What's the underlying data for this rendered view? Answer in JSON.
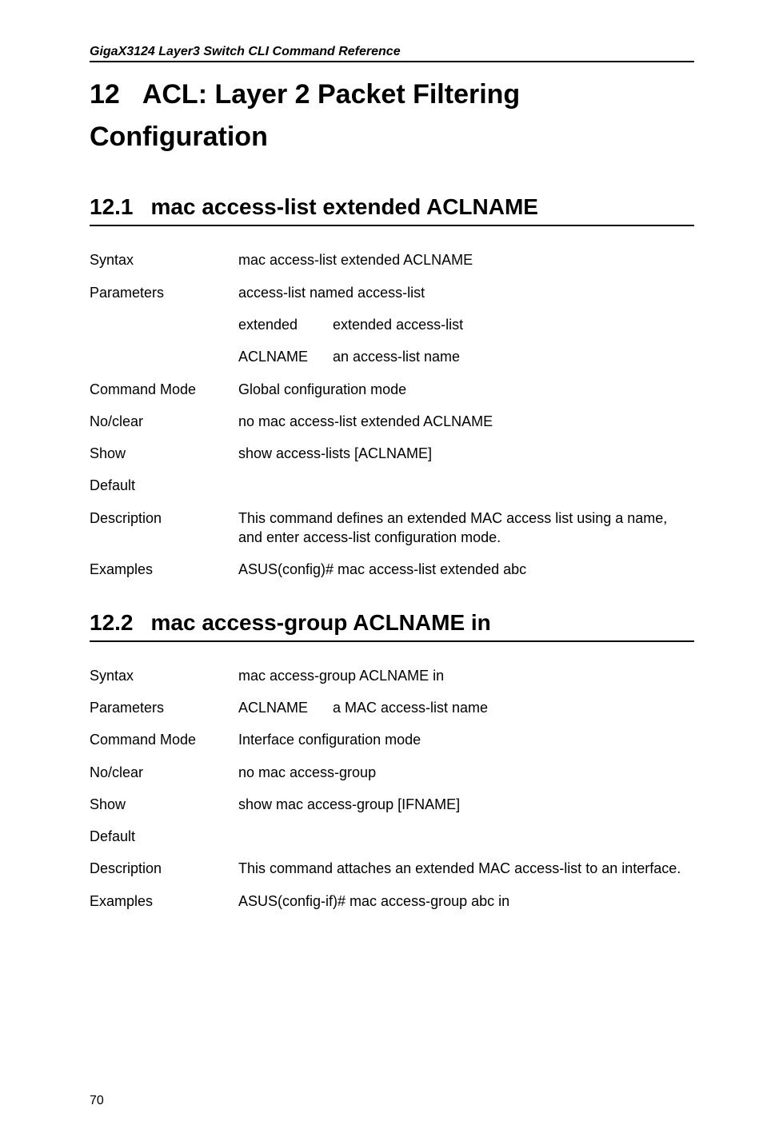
{
  "running_header": "GigaX3124 Layer3 Switch CLI Command Reference",
  "chapter": {
    "number": "12",
    "title": "ACL: Layer 2 Packet Filtering Configuration"
  },
  "section1": {
    "number": "12.1",
    "title": "mac access-list extended ACLNAME",
    "rows": {
      "syntax_label": "Syntax",
      "syntax_value": "mac access-list extended ACLNAME",
      "parameters_label": "Parameters",
      "parameters_value": "access-list named access-list",
      "param_extended_key": "extended",
      "param_extended_val": "extended access-list",
      "param_aclname_key": "ACLNAME",
      "param_aclname_val": "an access-list name",
      "command_mode_label": "Command Mode",
      "command_mode_value": "Global configuration mode",
      "noclear_label": "No/clear",
      "noclear_value": "no mac access-list extended ACLNAME",
      "show_label": "Show",
      "show_value": "show access-lists [ACLNAME]",
      "default_label": "Default",
      "default_value": "",
      "description_label": "Description",
      "description_value": "This command defines an extended MAC access list using a name, and enter access-list configuration mode.",
      "examples_label": "Examples",
      "examples_value": "ASUS(config)# mac access-list extended abc"
    }
  },
  "section2": {
    "number": "12.2",
    "title": "mac access-group ACLNAME in",
    "rows": {
      "syntax_label": "Syntax",
      "syntax_value": "mac access-group ACLNAME in",
      "parameters_label": "Parameters",
      "param_aclname_key": "ACLNAME",
      "param_aclname_val": "a MAC access-list name",
      "command_mode_label": "Command Mode",
      "command_mode_value": "Interface configuration mode",
      "noclear_label": "No/clear",
      "noclear_value": "no mac access-group",
      "show_label": "Show",
      "show_value": "show mac access-group [IFNAME]",
      "default_label": "Default",
      "default_value": "",
      "description_label": "Description",
      "description_value": "This command attaches an extended MAC access-list to an interface.",
      "examples_label": "Examples",
      "examples_value": "ASUS(config-if)# mac access-group abc in"
    }
  },
  "page_number": "70"
}
